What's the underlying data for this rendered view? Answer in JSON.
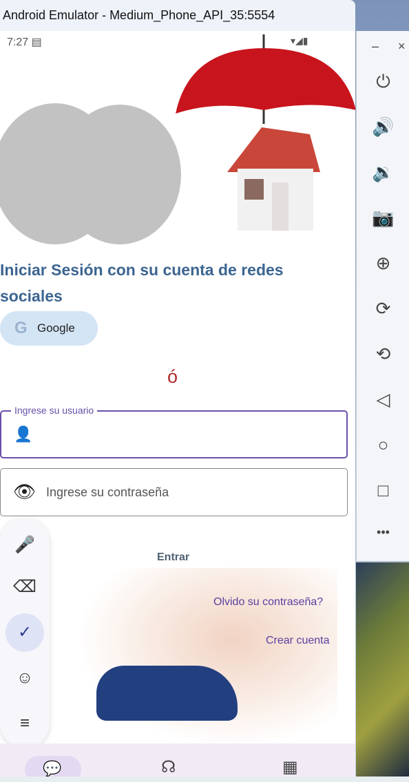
{
  "window": {
    "title": "Android Emulator - Medium_Phone_API_35:5554"
  },
  "status": {
    "time": "7:27",
    "calendar_icon": "▤",
    "right_icons": "▾◢▮"
  },
  "app": {
    "heading": "Iniciar Sesión con su cuenta de redes sociales",
    "google_label": "Google",
    "google_icon": "G",
    "separator": "ó",
    "username_label": "Ingrese su usuario",
    "username_value": "",
    "password_placeholder": "Ingrese su contraseña",
    "enter_label": "Entrar",
    "forgot_label": "Olvido su contraseña?",
    "create_label": "Crear cuenta"
  },
  "keyboard": {
    "items": [
      "🎤",
      "⌫",
      "✓",
      "☺",
      "≡"
    ]
  },
  "side": {
    "minimize": "–",
    "close": "×",
    "icons": [
      "⏻",
      "🔊",
      "🔉",
      "📷",
      "⊕",
      "⟳",
      "⟲",
      "◁",
      "○",
      "□",
      "•••"
    ]
  },
  "colors": {
    "accent": "#6a4fa8",
    "heading": "#3c6591",
    "separator": "#b02a2a"
  }
}
